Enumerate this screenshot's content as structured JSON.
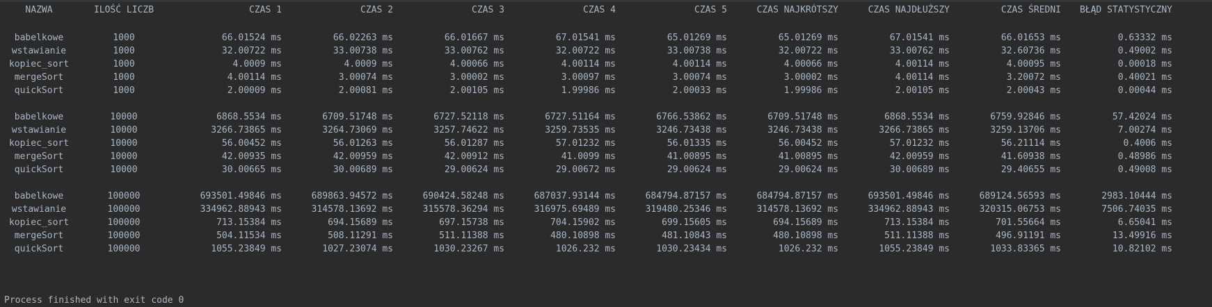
{
  "headers": {
    "name": "NAZWA",
    "count": "ILOŚĆ LICZB",
    "t1": "CZAS 1",
    "t2": "CZAS 2",
    "t3": "CZAS 3",
    "t4": "CZAS 4",
    "t5": "CZAS 5",
    "min": "CZAS NAJKRÓTSZY",
    "max": "CZAS NAJDŁUŻSZY",
    "avg": "CZAS ŚREDNI",
    "err": "BŁĄD STATYSTYCZNY"
  },
  "rows": [
    {
      "name": "babelkowe",
      "count": "1000",
      "t1": "66.01524 ms",
      "t2": "66.02263 ms",
      "t3": "66.01667 ms",
      "t4": "67.01541 ms",
      "t5": "65.01269 ms",
      "min": "65.01269 ms",
      "max": "67.01541 ms",
      "avg": "66.01653 ms",
      "err": "0.63332 ms"
    },
    {
      "name": "wstawianie",
      "count": "1000",
      "t1": "32.00722 ms",
      "t2": "33.00738 ms",
      "t3": "33.00762 ms",
      "t4": "32.00722 ms",
      "t5": "33.00738 ms",
      "min": "32.00722 ms",
      "max": "33.00762 ms",
      "avg": "32.60736 ms",
      "err": "0.49002 ms"
    },
    {
      "name": "kopiec_sort",
      "count": "1000",
      "t1": "4.0009 ms",
      "t2": "4.0009 ms",
      "t3": "4.00066 ms",
      "t4": "4.00114 ms",
      "t5": "4.00114 ms",
      "min": "4.00066 ms",
      "max": "4.00114 ms",
      "avg": "4.00095 ms",
      "err": "0.00018 ms"
    },
    {
      "name": "mergeSort",
      "count": "1000",
      "t1": "4.00114 ms",
      "t2": "3.00074 ms",
      "t3": "3.00002 ms",
      "t4": "3.00097 ms",
      "t5": "3.00074 ms",
      "min": "3.00002 ms",
      "max": "4.00114 ms",
      "avg": "3.20072 ms",
      "err": "0.40021 ms"
    },
    {
      "name": "quickSort",
      "count": "1000",
      "t1": "2.00009 ms",
      "t2": "2.00081 ms",
      "t3": "2.00105 ms",
      "t4": "1.99986 ms",
      "t5": "2.00033 ms",
      "min": "1.99986 ms",
      "max": "2.00105 ms",
      "avg": "2.00043 ms",
      "err": "0.00044 ms"
    },
    {
      "name": "babelkowe",
      "count": "10000",
      "t1": "6868.5534 ms",
      "t2": "6709.51748 ms",
      "t3": "6727.52118 ms",
      "t4": "6727.51164 ms",
      "t5": "6766.53862 ms",
      "min": "6709.51748 ms",
      "max": "6868.5534 ms",
      "avg": "6759.92846 ms",
      "err": "57.42024 ms"
    },
    {
      "name": "wstawianie",
      "count": "10000",
      "t1": "3266.73865 ms",
      "t2": "3264.73069 ms",
      "t3": "3257.74622 ms",
      "t4": "3259.73535 ms",
      "t5": "3246.73438 ms",
      "min": "3246.73438 ms",
      "max": "3266.73865 ms",
      "avg": "3259.13706 ms",
      "err": "7.00274 ms"
    },
    {
      "name": "kopiec_sort",
      "count": "10000",
      "t1": "56.00452 ms",
      "t2": "56.01263 ms",
      "t3": "56.01287 ms",
      "t4": "57.01232 ms",
      "t5": "56.01335 ms",
      "min": "56.00452 ms",
      "max": "57.01232 ms",
      "avg": "56.21114 ms",
      "err": "0.4006 ms"
    },
    {
      "name": "mergeSort",
      "count": "10000",
      "t1": "42.00935 ms",
      "t2": "42.00959 ms",
      "t3": "42.00912 ms",
      "t4": "41.0099 ms",
      "t5": "41.00895 ms",
      "min": "41.00895 ms",
      "max": "42.00959 ms",
      "avg": "41.60938 ms",
      "err": "0.48986 ms"
    },
    {
      "name": "quickSort",
      "count": "10000",
      "t1": "30.00665 ms",
      "t2": "30.00689 ms",
      "t3": "29.00624 ms",
      "t4": "29.00672 ms",
      "t5": "29.00624 ms",
      "min": "29.00624 ms",
      "max": "30.00689 ms",
      "avg": "29.40655 ms",
      "err": "0.49008 ms"
    },
    {
      "name": "babelkowe",
      "count": "100000",
      "t1": "693501.49846 ms",
      "t2": "689863.94572 ms",
      "t3": "690424.58248 ms",
      "t4": "687037.93144 ms",
      "t5": "684794.87157 ms",
      "min": "684794.87157 ms",
      "max": "693501.49846 ms",
      "avg": "689124.56593 ms",
      "err": "2983.10444 ms"
    },
    {
      "name": "wstawianie",
      "count": "100000",
      "t1": "334962.88943 ms",
      "t2": "314578.13692 ms",
      "t3": "315578.36294 ms",
      "t4": "316975.69489 ms",
      "t5": "319480.25346 ms",
      "min": "314578.13692 ms",
      "max": "334962.88943 ms",
      "avg": "320315.06753 ms",
      "err": "7506.74035 ms"
    },
    {
      "name": "kopiec_sort",
      "count": "100000",
      "t1": "713.15384 ms",
      "t2": "694.15689 ms",
      "t3": "697.15738 ms",
      "t4": "704.15902 ms",
      "t5": "699.15605 ms",
      "min": "694.15689 ms",
      "max": "713.15384 ms",
      "avg": "701.55664 ms",
      "err": "6.65041 ms"
    },
    {
      "name": "mergeSort",
      "count": "100000",
      "t1": "504.11534 ms",
      "t2": "508.11291 ms",
      "t3": "511.11388 ms",
      "t4": "480.10898 ms",
      "t5": "481.10843 ms",
      "min": "480.10898 ms",
      "max": "511.11388 ms",
      "avg": "496.91191 ms",
      "err": "13.49916 ms"
    },
    {
      "name": "quickSort",
      "count": "100000",
      "t1": "1055.23849 ms",
      "t2": "1027.23074 ms",
      "t3": "1030.23267 ms",
      "t4": "1026.232 ms",
      "t5": "1030.23434 ms",
      "min": "1026.232 ms",
      "max": "1055.23849 ms",
      "avg": "1033.83365 ms",
      "err": "10.82102 ms"
    }
  ],
  "status": "Process finished with exit code 0"
}
